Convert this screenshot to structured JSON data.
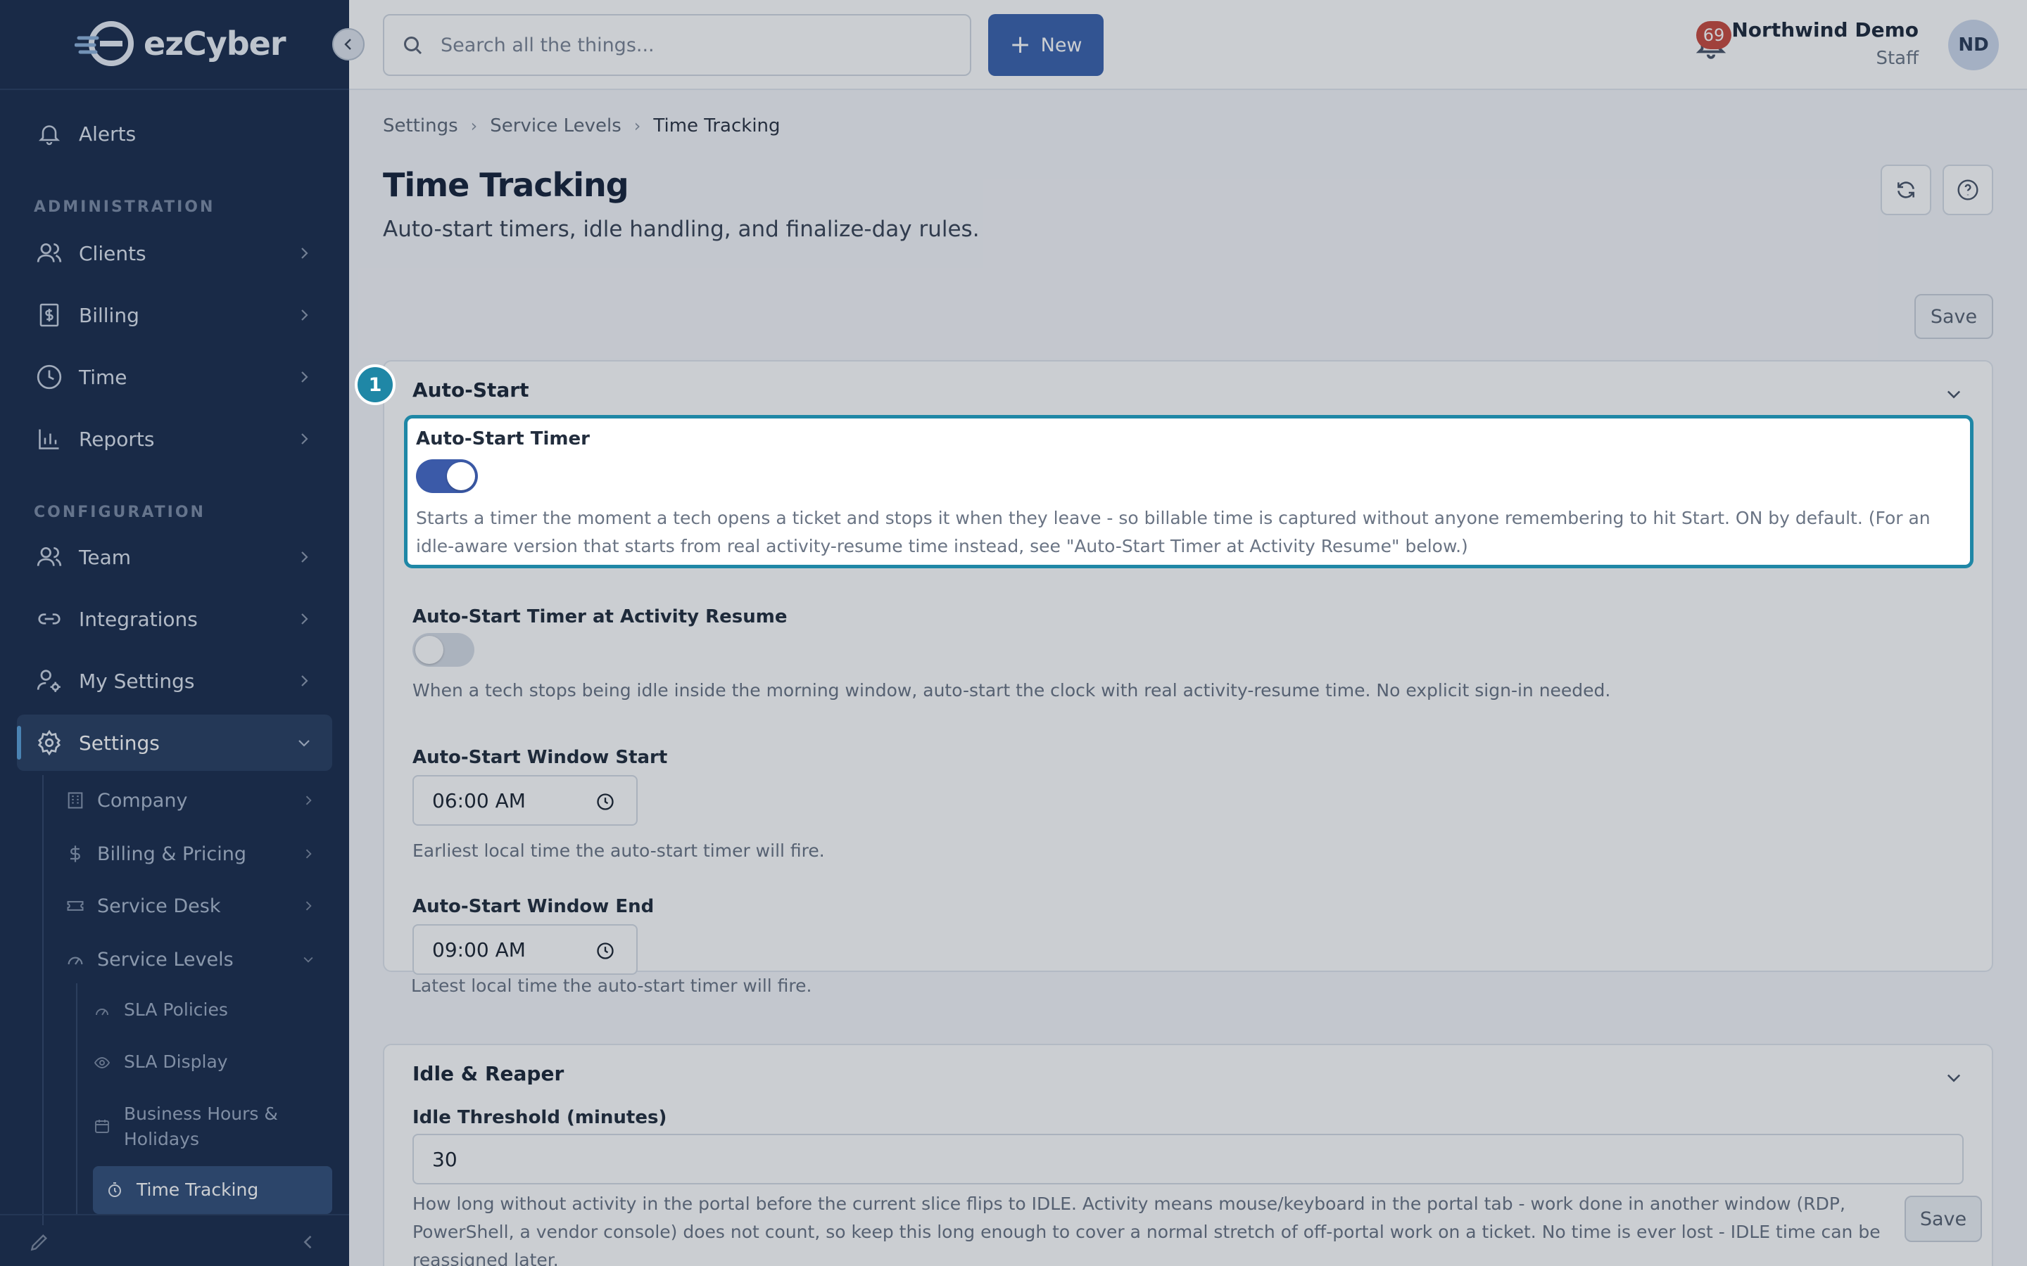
{
  "app": {
    "logo_text": "ezCyber"
  },
  "sidebar": {
    "alerts": "Alerts",
    "section_admin": "ADMINISTRATION",
    "clients": "Clients",
    "billing": "Billing",
    "time": "Time",
    "reports": "Reports",
    "section_config": "CONFIGURATION",
    "team": "Team",
    "integrations": "Integrations",
    "my_settings": "My Settings",
    "settings": "Settings",
    "sub": {
      "company": "Company",
      "billing_pricing": "Billing & Pricing",
      "service_desk": "Service Desk",
      "service_levels": "Service Levels",
      "sla_policies": "SLA Policies",
      "sla_display": "SLA Display",
      "business_hours": "Business Hours & Holidays",
      "time_tracking": "Time Tracking"
    }
  },
  "topbar": {
    "search_placeholder": "Search all the things...",
    "new_label": "New",
    "notification_count": "69",
    "user_name": "Northwind Demo",
    "user_role": "Staff",
    "avatar_initials": "ND"
  },
  "breadcrumb": [
    "Settings",
    "Service Levels",
    "Time Tracking"
  ],
  "page": {
    "title": "Time Tracking",
    "subtitle": "Auto-start timers, idle handling, and finalize-day rules.",
    "save_label": "Save"
  },
  "tour": {
    "step": "1"
  },
  "auto_start": {
    "title": "Auto-Start",
    "timer_label": "Auto-Start Timer",
    "timer_on": true,
    "timer_desc": "Starts a timer the moment a tech opens a ticket and stops it when they leave - so billable time is captured without anyone remembering to hit Start. ON by default. (For an idle-aware version that starts from real activity-resume time instead, see \"Auto-Start Timer at Activity Resume\" below.)",
    "resume_label": "Auto-Start Timer at Activity Resume",
    "resume_on": false,
    "resume_desc": "When a tech stops being idle inside the morning window, auto-start the clock with real activity-resume time. No explicit sign-in needed.",
    "window_start_label": "Auto-Start Window Start",
    "window_start_value": "06:00 AM",
    "window_start_desc": "Earliest local time the auto-start timer will fire.",
    "window_end_label": "Auto-Start Window End",
    "window_end_value": "09:00 AM",
    "window_end_desc": "Latest local time the auto-start timer will fire."
  },
  "idle": {
    "title": "Idle & Reaper",
    "threshold_label": "Idle Threshold (minutes)",
    "threshold_value": "30",
    "threshold_desc": "How long without activity in the portal before the current slice flips to IDLE. Activity means mouse/keyboard in the portal tab - work done in another window (RDP, PowerShell, a vendor console) does not count, so keep this long enough to cover a normal stretch of off-portal work on a ticket. No time is ever lost - IDLE time can be reassigned later."
  },
  "colors": {
    "sidebar_bg": "#1b2d4d",
    "accent": "#3b5aa8",
    "spotlight": "#1f87a6",
    "badge": "#c84b3f"
  }
}
